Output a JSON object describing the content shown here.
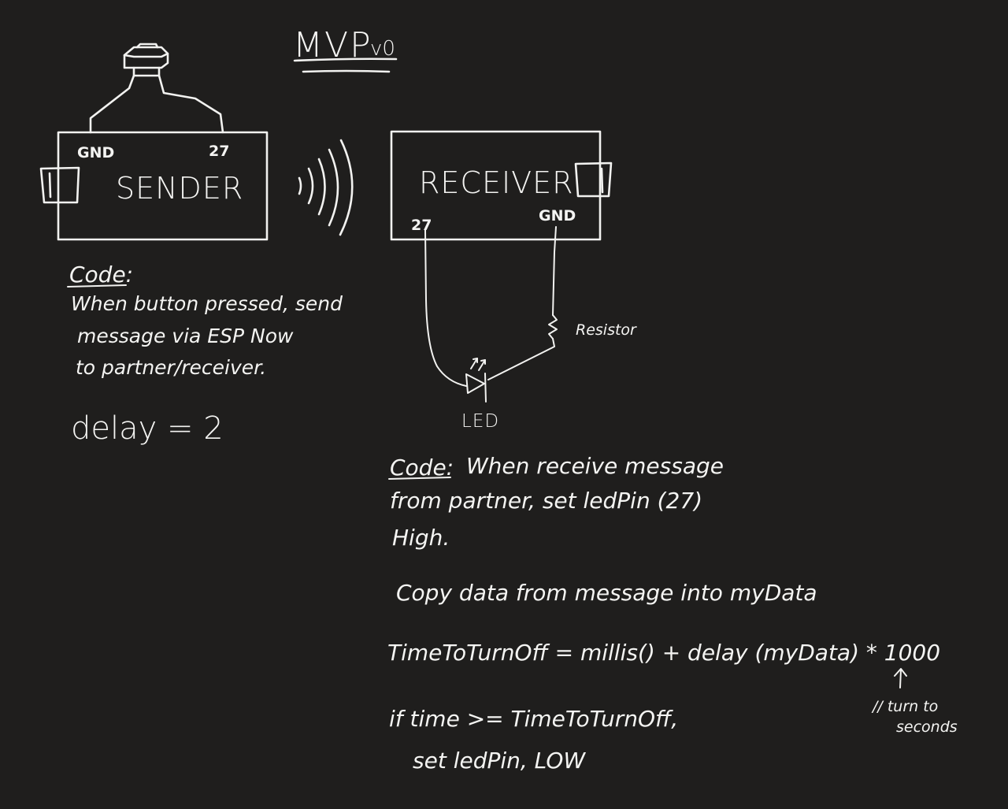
{
  "title": "MVP",
  "version": "v0",
  "sender": {
    "label": "SENDER",
    "pin_left": "GND",
    "pin_right": "27",
    "code_heading": "Code:",
    "code_lines": [
      "When button pressed, send",
      "message via ESP Now",
      "to partner/receiver."
    ],
    "delay_line": "delay = 2"
  },
  "receiver": {
    "label": "RECEIVER",
    "pin_left": "27",
    "pin_right": "GND",
    "resistor_label": "Resistor",
    "led_label": "LED",
    "code_heading": "Code:",
    "code_first_line": "When receive message",
    "code_lines": [
      "from partner, set ledPin (27)",
      "High."
    ],
    "copy_line": "Copy data from message into myData",
    "formula_line": "TimeToTurnOff = millis() + delay (myData) * 1000",
    "if_line": "if  time  >= TimeToTurnOff,",
    "set_line": "set  ledPin, LOW",
    "annotation_lines": [
      "// turn to",
      "seconds"
    ]
  },
  "colors": {
    "background": "#1f1e1d",
    "ink": "#f2f2f0"
  }
}
